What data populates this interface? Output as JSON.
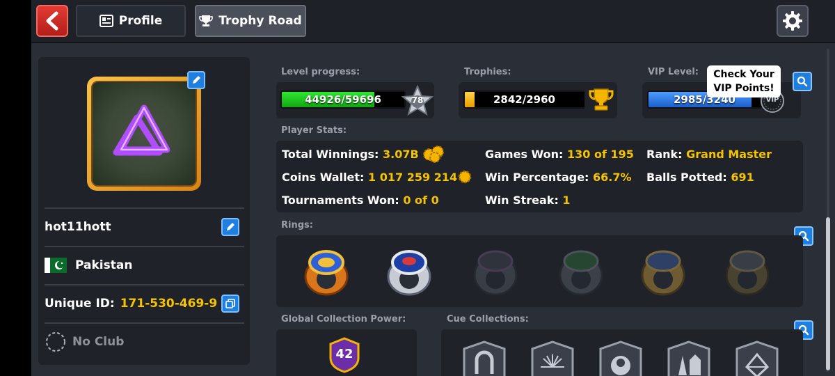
{
  "topbar": {
    "back_label": "back",
    "tabs": [
      {
        "label": "Profile",
        "icon": "profile-card-icon",
        "active": false
      },
      {
        "label": "Trophy Road",
        "icon": "trophy-icon",
        "active": true
      }
    ],
    "settings_icon": "gear-icon"
  },
  "player": {
    "username": "hot11hott",
    "country": "Pakistan",
    "unique_id_label": "Unique ID:",
    "unique_id": "171-530-469-9",
    "club": "No Club"
  },
  "level": {
    "label": "Level progress:",
    "value_text": "44926/59696",
    "progress": 0.753,
    "level_number": "78",
    "color": "#19c11b"
  },
  "trophies": {
    "label": "Trophies:",
    "value_text": "2842/2960",
    "progress": 0.08,
    "color": "#f5b400"
  },
  "vip": {
    "label": "VIP Level:",
    "value_text": "2985/3240",
    "progress": 0.92,
    "badge": "VIP",
    "color": "#2e7ee8",
    "tooltip_line1": "Check Your",
    "tooltip_line2": "VIP Points!"
  },
  "stats": {
    "label": "Player Stats:",
    "total_winnings_label": "Total Winnings:",
    "total_winnings": "3.07B",
    "coins_wallet_label": "Coins Wallet:",
    "coins_wallet": "1 017 259 214",
    "tournaments_won_label": "Tournaments Won:",
    "tournaments_won": "0 of 0",
    "games_won_label": "Games Won:",
    "games_won": "130 of 195",
    "win_percentage_label": "Win Percentage:",
    "win_percentage": "66.7%",
    "win_streak_label": "Win Streak:",
    "win_streak": "1",
    "rank_label": "Rank:",
    "rank": "Grand Master",
    "balls_potted_label": "Balls Potted:",
    "balls_potted": "691"
  },
  "rings": {
    "label": "Rings:",
    "items": [
      {
        "name": "ring-1",
        "owned": true
      },
      {
        "name": "ring-2",
        "owned": true
      },
      {
        "name": "ring-3",
        "owned": false
      },
      {
        "name": "ring-4",
        "owned": false
      },
      {
        "name": "ring-5",
        "owned": false
      },
      {
        "name": "ring-6",
        "owned": false
      }
    ]
  },
  "collection": {
    "global_label": "Global Collection Power:",
    "global_power": "42",
    "cue_label": "Cue Collections:",
    "cue_items": [
      "horseshoe-icon",
      "fireworks-icon",
      "eight-ball-icon",
      "landmarks-icon",
      "gem-icon"
    ]
  }
}
